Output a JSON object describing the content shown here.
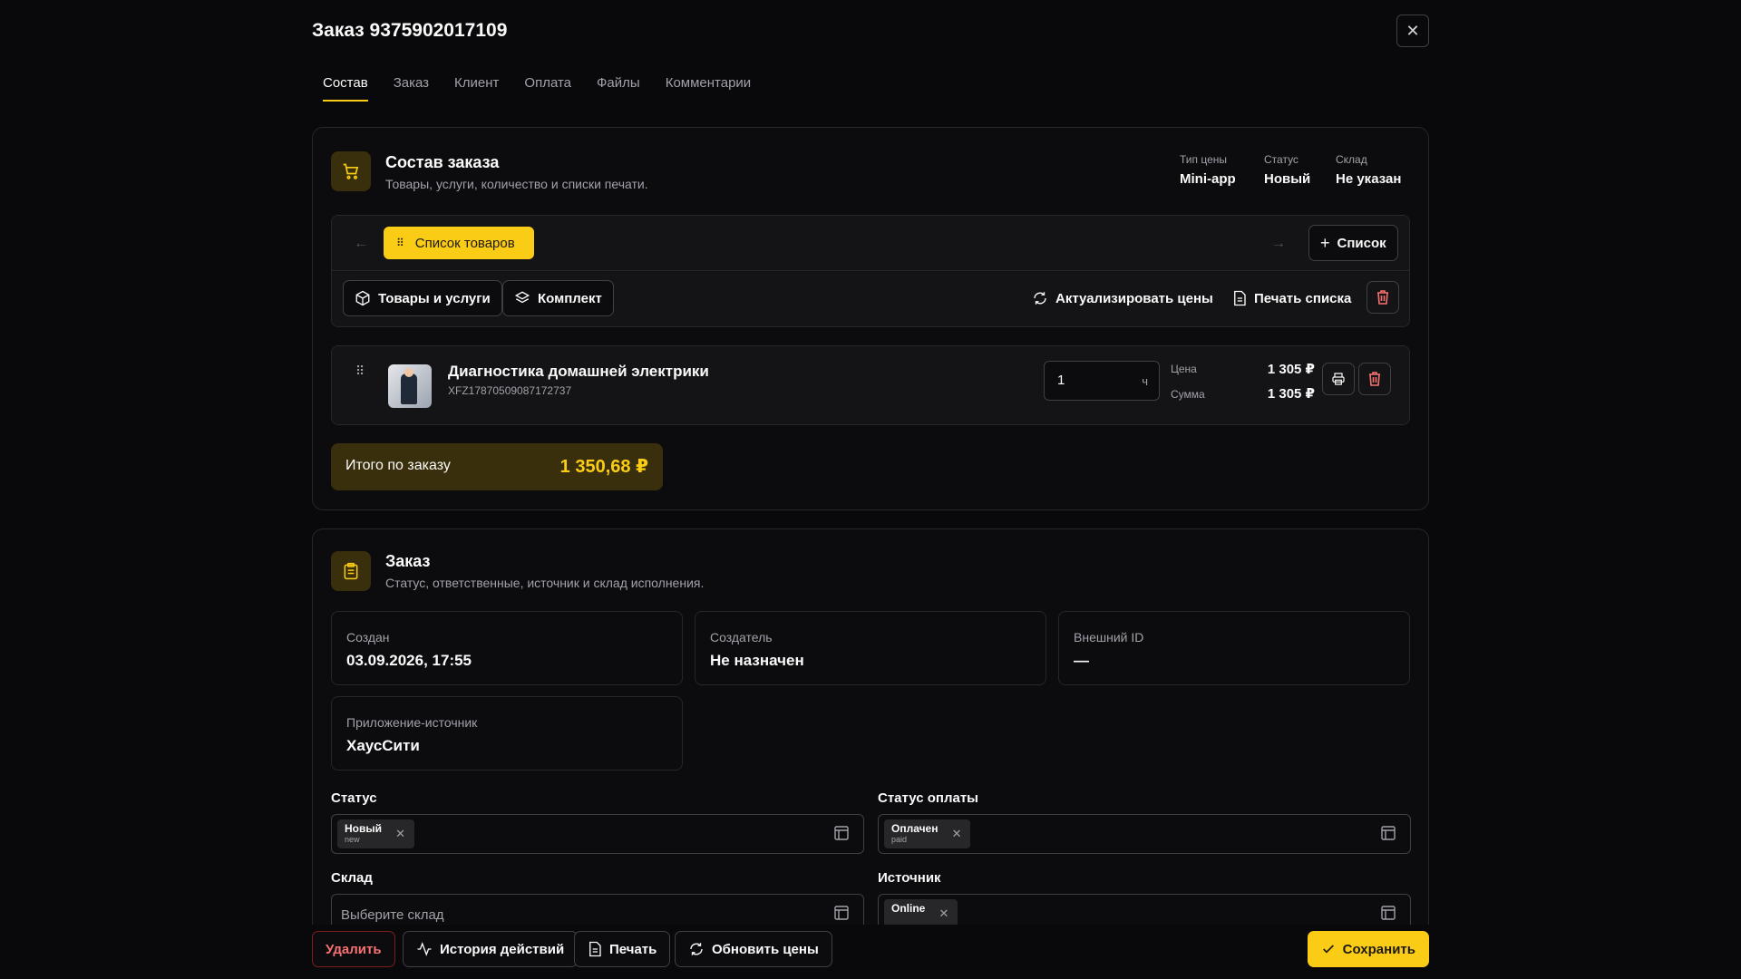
{
  "header": {
    "title": "Заказ 9375902017109",
    "close_icon": "close-icon"
  },
  "tabs": [
    {
      "label": "Состав",
      "active": true
    },
    {
      "label": "Заказ",
      "active": false
    },
    {
      "label": "Клиент",
      "active": false
    },
    {
      "label": "Оплата",
      "active": false
    },
    {
      "label": "Файлы",
      "active": false
    },
    {
      "label": "Комментарии",
      "active": false
    }
  ],
  "composition": {
    "title": "Состав заказа",
    "subtitle": "Товары, услуги, количество и списки печати.",
    "meta": [
      {
        "label": "Тип цены",
        "value": "Mini-app"
      },
      {
        "label": "Статус",
        "value": "Новый"
      },
      {
        "label": "Склад",
        "value": "Не указан"
      }
    ],
    "active_list": "Список товаров",
    "add_list": "Список",
    "goods_button": "Товары и услуги",
    "kit_button": "Комплект",
    "refresh_prices": "Актуализировать цены",
    "print_list": "Печать списка",
    "item": {
      "name": "Диагностика домашней электрики",
      "sku": "XFZ17870509087172737",
      "qty": "1",
      "unit": "ч",
      "price_label": "Цена",
      "price": "1 305 ₽",
      "sum_label": "Сумма",
      "sum": "1 305 ₽"
    },
    "total_label": "Итого по заказу",
    "total_value": "1 350,68 ₽"
  },
  "order": {
    "title": "Заказ",
    "subtitle": "Статус, ответственные, источник и склад исполнения.",
    "fields": {
      "created_label": "Создан",
      "created": "03.09.2026, 17:55",
      "creator_label": "Создатель",
      "creator": "Не назначен",
      "external_label": "Внешний ID",
      "external": "—",
      "app_label": "Приложение-источник",
      "app": "ХаусСити"
    },
    "status_label": "Статус",
    "status_tag": "Новый",
    "status_code": "new",
    "payment_label": "Статус оплаты",
    "payment_tag": "Оплачен",
    "payment_code": "paid",
    "warehouse_label": "Склад",
    "warehouse_placeholder": "Выберите склад",
    "source_label": "Источник",
    "source_tag": "Online"
  },
  "footer": {
    "delete": "Удалить",
    "history": "История действий",
    "print": "Печать",
    "update_prices": "Обновить цены",
    "save": "Сохранить"
  },
  "colors": {
    "accent": "#facc15",
    "danger": "#f87171",
    "background": "#09090b"
  }
}
